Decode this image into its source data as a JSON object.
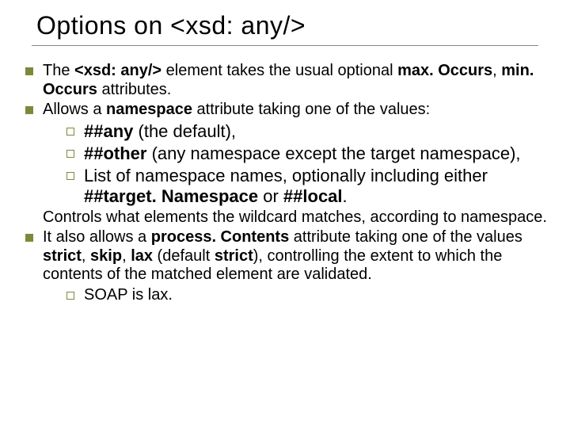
{
  "title": "Options on <xsd: any/>",
  "bullets": {
    "b1_pre": "The ",
    "b1_strong1": "<xsd: any/>",
    "b1_mid": " element takes the usual optional ",
    "b1_strong2": "max. Occurs",
    "b1_sep": ", ",
    "b1_strong3": "min. Occurs",
    "b1_post": " attributes.",
    "b2_pre": "Allows a ",
    "b2_strong": "namespace",
    "b2_post": " attribute taking one of the values:",
    "s1_strong": "##any",
    "s1_post": " (the default),",
    "s2_strong": "##other",
    "s2_post": " (any namespace except the target namespace),",
    "s3_pre": "List of namespace names, optionally including either ",
    "s3_strong1": "##target. Namespace",
    "s3_mid": " or ",
    "s3_strong2": "##local",
    "s3_post": ".",
    "p1": "Controls what elements the wildcard matches, according to namespace.",
    "b3_pre": "It also allows a ",
    "b3_strong1": "process. Contents",
    "b3_mid1": " attribute taking one of the values ",
    "b3_strong2": "strict",
    "b3_sep1": ", ",
    "b3_strong3": "skip",
    "b3_sep2": ", ",
    "b3_strong4": "lax",
    "b3_mid2": " (default ",
    "b3_strong5": "strict",
    "b3_post": "), controlling the extent to which the contents of the matched element are validated.",
    "s4": "SOAP is lax."
  }
}
